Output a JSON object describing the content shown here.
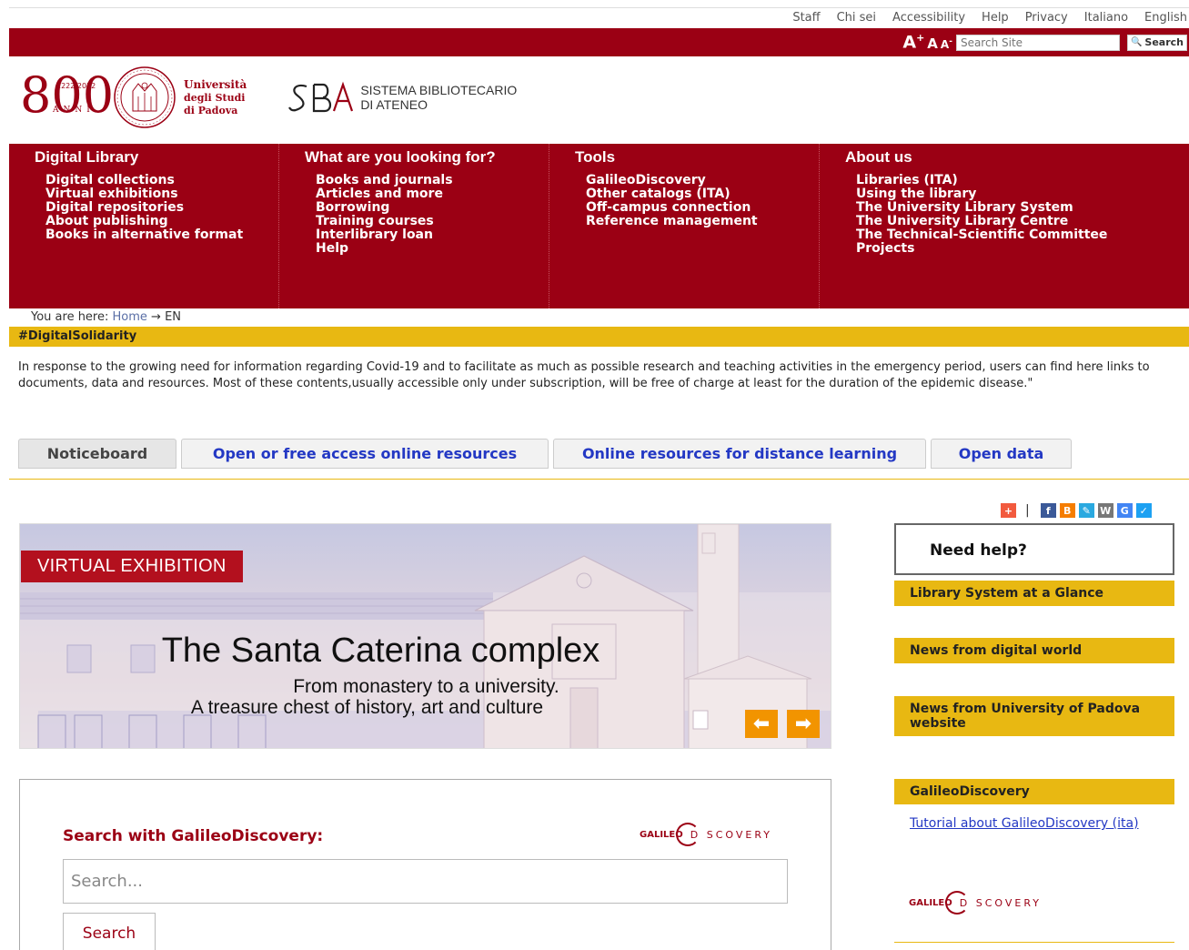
{
  "top_nav": [
    "Staff",
    "Chi sei",
    "Accessibility",
    "Help",
    "Privacy",
    "Italiano",
    "English"
  ],
  "font_size": {
    "large": "A",
    "medium": "A",
    "small": "A"
  },
  "site_search": {
    "placeholder": "Search Site",
    "button": "Search"
  },
  "logos": {
    "anniversary_years": "1222·2022",
    "anniversary_number": "800",
    "anniversary_anni": "ANNI",
    "university_line1": "Università",
    "university_line2": "degli Studi",
    "university_line3": "di Padova",
    "sba_mark": "SBA",
    "sba_line1": "SISTEMA BIBLIOTECARIO",
    "sba_line2": "DI ATENEO"
  },
  "menu": [
    {
      "heading": "Digital Library",
      "items": [
        "Digital collections",
        "Virtual exhibitions",
        "Digital repositories",
        "About publishing",
        "Books in alternative format"
      ]
    },
    {
      "heading": "What are you looking for?",
      "items": [
        "Books and journals",
        "Articles and more",
        "Borrowing",
        "Training courses",
        "Interlibrary loan",
        "Help"
      ]
    },
    {
      "heading": "Tools",
      "items": [
        "GalileoDiscovery",
        "Other catalogs (ITA)",
        "Off-campus connection",
        "Reference management"
      ]
    },
    {
      "heading": "About us",
      "items": [
        "Libraries (ITA)",
        "Using the library",
        "The University Library System",
        "The University Library Centre",
        "The Technical-Scientific Committee",
        "Projects"
      ]
    }
  ],
  "breadcrumb": {
    "prefix": "You are here:",
    "home": "Home",
    "arrow": "→",
    "current": "EN"
  },
  "solidarity_bar": "#DigitalSolidarity",
  "intro_text": "In response to the growing need for information regarding Covid-19 and to facilitate as much as possible research and teaching activities in the emergency period, users can find here links to documents, data and resources. Most of these contents,usually accessible only under subscription, will be free of charge at least for the duration of the epidemic disease.\"",
  "tabs": [
    "Noticeboard",
    "Open or free access online resources",
    "Online resources for distance learning",
    "Open data"
  ],
  "banner": {
    "label": "VIRTUAL EXHIBITION",
    "title": "The Santa Caterina complex",
    "subtitle1": "From monastery to a university.",
    "subtitle2": "A treasure chest of history, art and culture",
    "prev": "⬅",
    "next": "➡"
  },
  "discovery_search": {
    "title": "Search with GalileoDiscovery:",
    "logo_left": "GALILEO",
    "logo_right": "D SCOVERY",
    "placeholder": "Search...",
    "button": "Search"
  },
  "share_icons": [
    {
      "name": "addthis-icon",
      "glyph": "+",
      "color": "#f25a3e"
    },
    {
      "name": "facebook-icon",
      "glyph": "f",
      "color": "#3b5998"
    },
    {
      "name": "blogger-icon",
      "glyph": "B",
      "color": "#f57d00"
    },
    {
      "name": "delicious-icon",
      "glyph": "✎",
      "color": "#2aa9e0"
    },
    {
      "name": "wordpress-icon",
      "glyph": "W",
      "color": "#777777"
    },
    {
      "name": "google-icon",
      "glyph": "G",
      "color": "#4285f4"
    },
    {
      "name": "twitter-icon",
      "glyph": "✓",
      "color": "#1da1f2"
    }
  ],
  "sidebar": {
    "need_help": "Need help?",
    "buttons": [
      "Library System at a Glance",
      "News from digital world",
      "News from University of Padova website"
    ],
    "galileo_heading": "GalileoDiscovery",
    "tutorial_link": "Tutorial about GalileoDiscovery (ita)"
  }
}
